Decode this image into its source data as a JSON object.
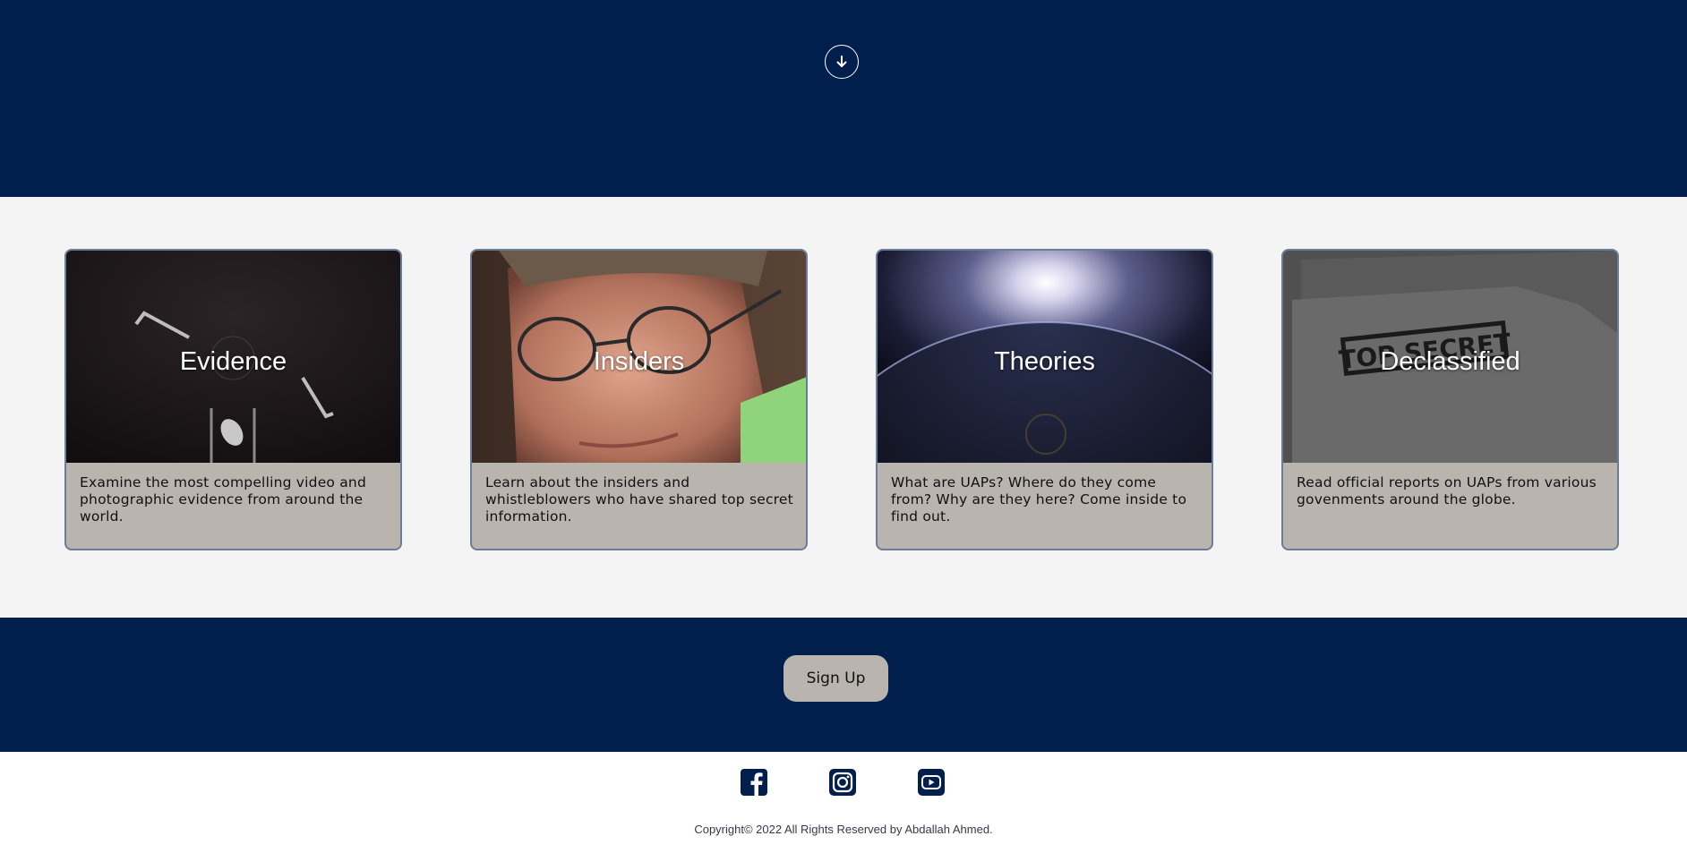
{
  "colors": {
    "navy": "#001f4d",
    "card_body": "#b9b4ae",
    "section_bg": "#f4f4f4"
  },
  "hero": {
    "scroll_icon": "arrow-down-circle-icon"
  },
  "cards": [
    {
      "title": "Evidence",
      "description": "Examine the most compelling video and photographic evidence from around the world.",
      "image": "ufo-photo"
    },
    {
      "title": "Insiders",
      "description": "Learn about the insiders and whistleblowers who have shared top secret information.",
      "image": "man-with-glasses-portrait"
    },
    {
      "title": "Theories",
      "description": "What are UAPs? Where do they come from? Why are they here? Come inside to find out.",
      "image": "planet-sunrise"
    },
    {
      "title": "Declassified",
      "description": "Read official reports on UAPs from various govenments around the globe.",
      "image": "top-secret-folder",
      "stamp_text": "TOP SECRET"
    }
  ],
  "signup": {
    "label": "Sign Up"
  },
  "footer": {
    "social": [
      "facebook-icon",
      "instagram-icon",
      "youtube-icon"
    ],
    "copyright": "Copyright© 2022 All Rights Reserved by Abdallah Ahmed."
  }
}
